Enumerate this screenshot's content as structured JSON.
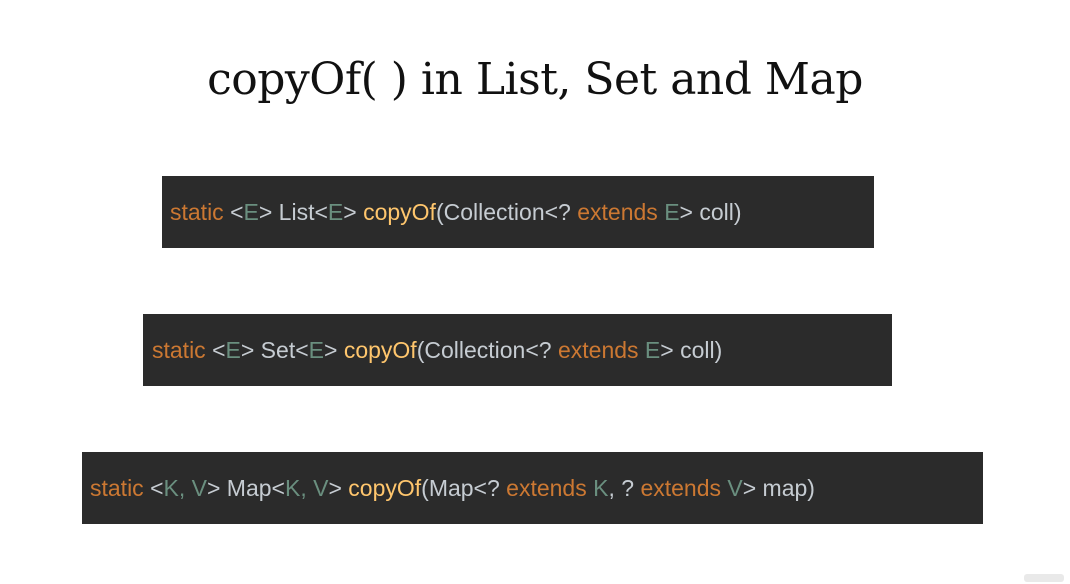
{
  "slide": {
    "title": "copyOf( ) in List, Set and Map"
  },
  "colors": {
    "background": "#ffffff",
    "code_background": "#2b2b2b",
    "keyword": "#cc7832",
    "type_param": "#6a8f7f",
    "plain": "#c6ccd2",
    "method": "#ffc66d"
  },
  "signatures": [
    {
      "id": "list",
      "tokens": [
        {
          "t": "static",
          "k": "kw"
        },
        {
          "t": " <",
          "k": "pl"
        },
        {
          "t": "E",
          "k": "tp"
        },
        {
          "t": "> List<",
          "k": "pl"
        },
        {
          "t": "E",
          "k": "tp"
        },
        {
          "t": "> ",
          "k": "pl"
        },
        {
          "t": "copyOf",
          "k": "fn"
        },
        {
          "t": "(Collection<? ",
          "k": "pl"
        },
        {
          "t": "extends",
          "k": "kw"
        },
        {
          "t": " ",
          "k": "pl"
        },
        {
          "t": "E",
          "k": "tp"
        },
        {
          "t": "> coll)",
          "k": "pl"
        }
      ]
    },
    {
      "id": "set",
      "tokens": [
        {
          "t": "static",
          "k": "kw"
        },
        {
          "t": " <",
          "k": "pl"
        },
        {
          "t": "E",
          "k": "tp"
        },
        {
          "t": "> Set<",
          "k": "pl"
        },
        {
          "t": "E",
          "k": "tp"
        },
        {
          "t": "> ",
          "k": "pl"
        },
        {
          "t": "copyOf",
          "k": "fn"
        },
        {
          "t": "(Collection<? ",
          "k": "pl"
        },
        {
          "t": "extends",
          "k": "kw"
        },
        {
          "t": " ",
          "k": "pl"
        },
        {
          "t": "E",
          "k": "tp"
        },
        {
          "t": "> coll)",
          "k": "pl"
        }
      ]
    },
    {
      "id": "map",
      "tokens": [
        {
          "t": "static",
          "k": "kw"
        },
        {
          "t": " <",
          "k": "pl"
        },
        {
          "t": "K, V",
          "k": "tp"
        },
        {
          "t": "> Map<",
          "k": "pl"
        },
        {
          "t": "K, V",
          "k": "tp"
        },
        {
          "t": "> ",
          "k": "pl"
        },
        {
          "t": "copyOf",
          "k": "fn"
        },
        {
          "t": "(Map<? ",
          "k": "pl"
        },
        {
          "t": "extends",
          "k": "kw"
        },
        {
          "t": " ",
          "k": "pl"
        },
        {
          "t": "K",
          "k": "tp"
        },
        {
          "t": ", ? ",
          "k": "pl"
        },
        {
          "t": "extends",
          "k": "kw"
        },
        {
          "t": " ",
          "k": "pl"
        },
        {
          "t": "V",
          "k": "tp"
        },
        {
          "t": "> map)",
          "k": "pl"
        }
      ]
    }
  ]
}
